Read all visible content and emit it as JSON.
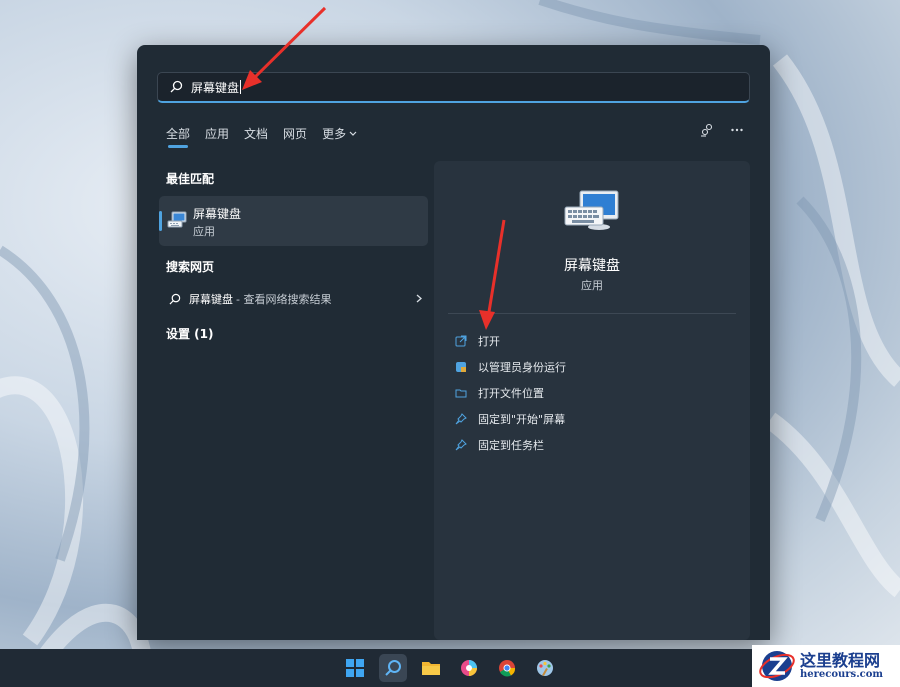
{
  "search": {
    "query": "屏幕键盘"
  },
  "tabs": [
    {
      "label": "全部",
      "active": true
    },
    {
      "label": "应用"
    },
    {
      "label": "文档"
    },
    {
      "label": "网页"
    },
    {
      "label": "更多"
    }
  ],
  "left": {
    "best_match_heading": "最佳匹配",
    "best_match": {
      "title": "屏幕键盘",
      "type": "应用"
    },
    "web_heading": "搜索网页",
    "web_result": {
      "query": "屏幕键盘",
      "suffix": "- 查看网络搜索结果"
    },
    "settings_heading": "设置 (1)"
  },
  "right": {
    "app_name": "屏幕键盘",
    "app_type": "应用",
    "actions": [
      {
        "label": "打开",
        "icon": "open-external-icon"
      },
      {
        "label": "以管理员身份运行",
        "icon": "shield-icon"
      },
      {
        "label": "打开文件位置",
        "icon": "folder-icon"
      },
      {
        "label": "固定到\"开始\"屏幕",
        "icon": "pin-icon"
      },
      {
        "label": "固定到任务栏",
        "icon": "pin-icon"
      }
    ]
  },
  "watermark": {
    "cn": "这里教程网",
    "en": "herecours.com"
  },
  "colors": {
    "accent": "#4fa3e0",
    "panel": "#202b35",
    "arrow": "#e8302a"
  }
}
